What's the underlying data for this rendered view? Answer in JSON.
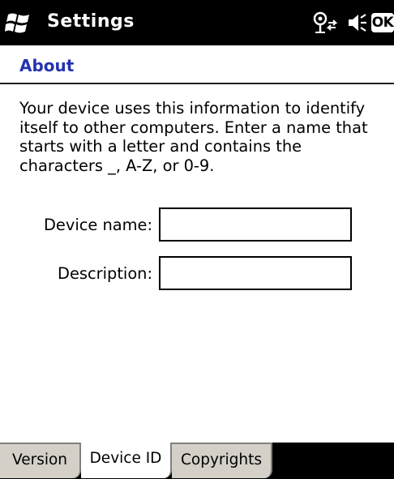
{
  "titlebar": {
    "start_icon": "windows-flag-icon",
    "title": "Settings",
    "connectivity_icon": "connectivity-icon",
    "volume_icon": "speaker-icon",
    "ok_label": "OK"
  },
  "section": {
    "title": "About"
  },
  "body": {
    "description": "Your device uses this information to identify itself to other computers. Enter a name that starts with a letter and contains the characters _, A-Z, or 0-9."
  },
  "form": {
    "device_name": {
      "label": "Device name:",
      "value": ""
    },
    "description": {
      "label": "Description:",
      "value": ""
    }
  },
  "tabs": [
    {
      "label": "Version",
      "selected": false
    },
    {
      "label": "Device ID",
      "selected": true
    },
    {
      "label": "Copyrights",
      "selected": false
    }
  ],
  "colors": {
    "titlebar_bg": "#000000",
    "section_title": "#2333b0",
    "tab_inactive_bg": "#d4d0c8",
    "tab_active_bg": "#ffffff"
  }
}
